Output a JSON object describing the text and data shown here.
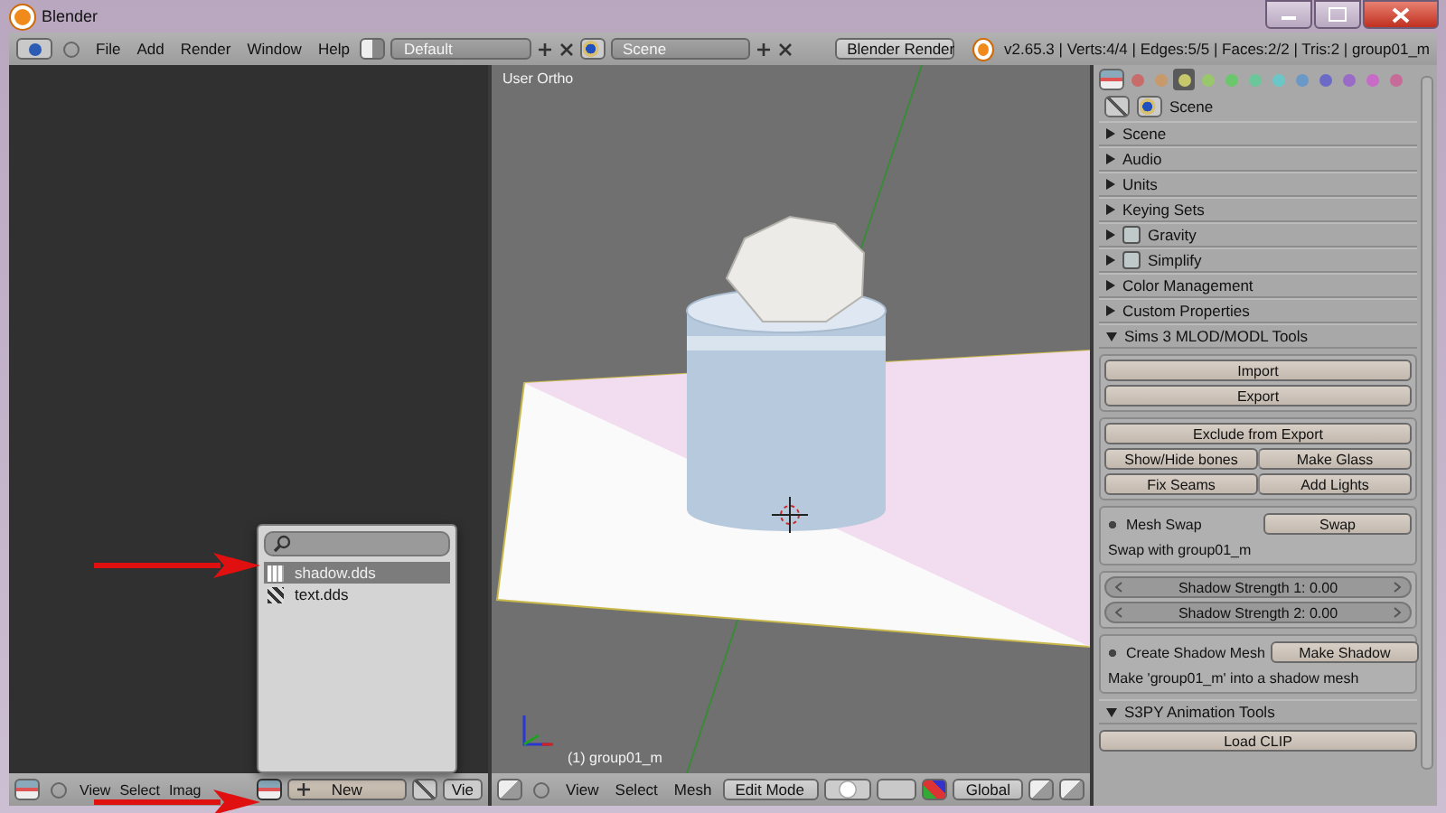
{
  "window": {
    "title": "Blender"
  },
  "top_bar": {
    "menu": [
      "File",
      "Add",
      "Render",
      "Window",
      "Help"
    ],
    "layout": "Default",
    "scene": "Scene",
    "render_engine": "Blender Render",
    "stats": "v2.65.3 | Verts:4/4 | Edges:5/5 | Faces:2/2 | Tris:2 | group01_m"
  },
  "image_editor": {
    "menu": [
      "View",
      "Select",
      "Imag"
    ],
    "new_button": "New",
    "view_button": "Vie",
    "popup": {
      "items": [
        {
          "label": "shadow.dds",
          "selected": true
        },
        {
          "label": "text.dds",
          "selected": false
        }
      ]
    }
  },
  "viewport": {
    "view_label": "User Ortho",
    "object_label": "(1) group01_m",
    "menu": [
      "View",
      "Select",
      "Mesh"
    ],
    "mode": "Edit Mode",
    "orientation": "Global"
  },
  "properties": {
    "tabs": [
      {
        "selected": false
      },
      {
        "selected": false
      },
      {
        "selected": true
      },
      {
        "selected": false
      },
      {
        "selected": false
      },
      {
        "selected": false
      },
      {
        "selected": false
      },
      {
        "selected": false
      },
      {
        "selected": false
      },
      {
        "selected": false
      },
      {
        "selected": false
      },
      {
        "selected": false
      }
    ],
    "context": "Scene",
    "panels": [
      {
        "title": "Scene",
        "expanded": false
      },
      {
        "title": "Audio",
        "expanded": false
      },
      {
        "title": "Units",
        "expanded": false
      },
      {
        "title": "Keying Sets",
        "expanded": false
      },
      {
        "title": "Gravity",
        "expanded": false,
        "checked": false
      },
      {
        "title": "Simplify",
        "expanded": false,
        "checked": false
      },
      {
        "title": "Color Management",
        "expanded": false
      },
      {
        "title": "Custom Properties",
        "expanded": false
      },
      {
        "title": "Sims 3 MLOD/MODL Tools",
        "expanded": true,
        "blocks": [
          {
            "kind": "box",
            "rows": [
              [
                "Import"
              ],
              [
                "Export"
              ]
            ]
          },
          {
            "kind": "box",
            "rows": [
              [
                "Exclude from Export"
              ],
              [
                "Show/Hide bones",
                "Make Glass"
              ],
              [
                "Fix Seams",
                "Add Lights"
              ]
            ]
          },
          {
            "kind": "action",
            "label": "Mesh Swap",
            "button": "Swap",
            "note": "Swap with group01_m"
          },
          {
            "kind": "sliders",
            "items": [
              "Shadow Strength 1: 0.00",
              "Shadow Strength 2: 0.00"
            ]
          },
          {
            "kind": "action",
            "label": "Create Shadow Mesh",
            "button": "Make Shadow",
            "note": "Make 'group01_m' into a shadow mesh"
          }
        ]
      },
      {
        "title": "S3PY Animation Tools",
        "expanded": true,
        "blocks": [
          {
            "kind": "plain",
            "rows": [
              [
                "Load CLIP"
              ]
            ]
          }
        ]
      }
    ]
  }
}
